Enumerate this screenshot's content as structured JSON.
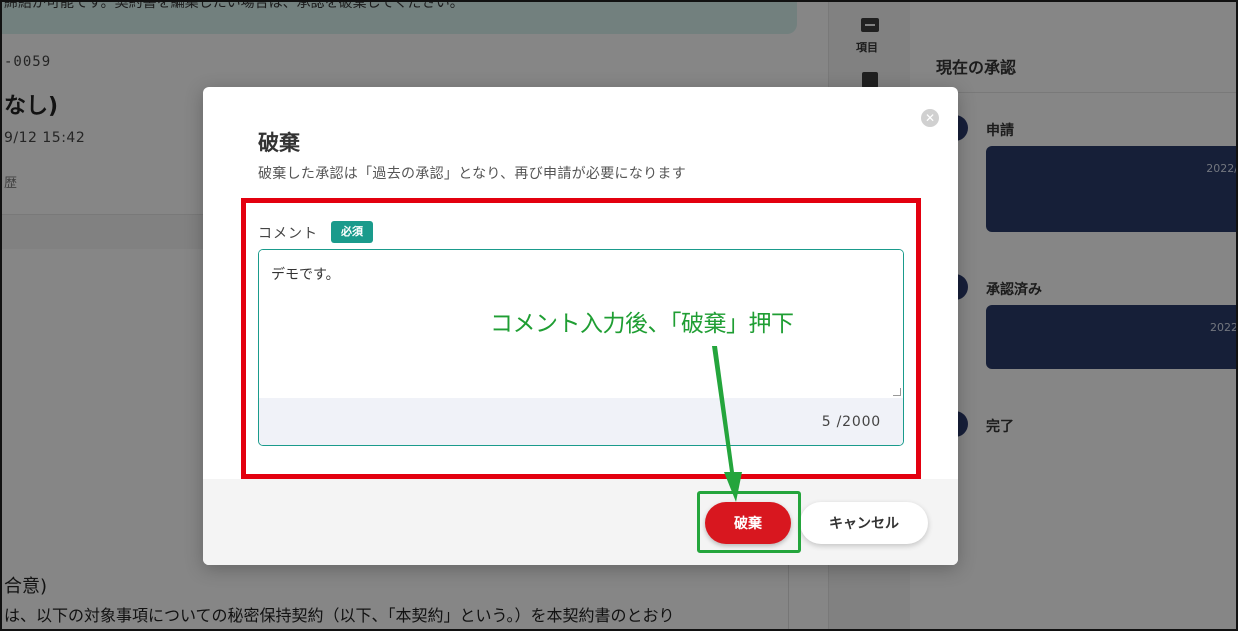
{
  "background": {
    "banner_text": "締結が可能です。契約書を編集したい場合は、承認を破棄してください。",
    "doc_id": "-0059",
    "doc_title": "なし)",
    "doc_date": "9/12 15:42",
    "doc_history": "歴",
    "clause_title": "合意)",
    "clause_text": "は、以下の対象事項についての秘密保持契約（以下、「本契約」という。）を本契約書のとおり"
  },
  "side_nav": {
    "item_label": "項目"
  },
  "approval_panel": {
    "title": "現在の承認",
    "steps": [
      {
        "label": "申請",
        "date": "2022/"
      },
      {
        "label": "承認済み",
        "date": "2022"
      },
      {
        "label": "完了"
      }
    ]
  },
  "dialog": {
    "title": "破棄",
    "description": "破棄した承認は「過去の承認」となり、再び申請が必要になります",
    "comment_label": "コメント",
    "required_badge": "必須",
    "comment_value": "デモです。",
    "counter": "5 /2000",
    "discard_label": "破棄",
    "cancel_label": "キャンセル"
  },
  "annotation": {
    "instruction": "コメント入力後、「破棄」押下",
    "colors": {
      "red": "#e3000f",
      "green": "#24a53c"
    }
  }
}
